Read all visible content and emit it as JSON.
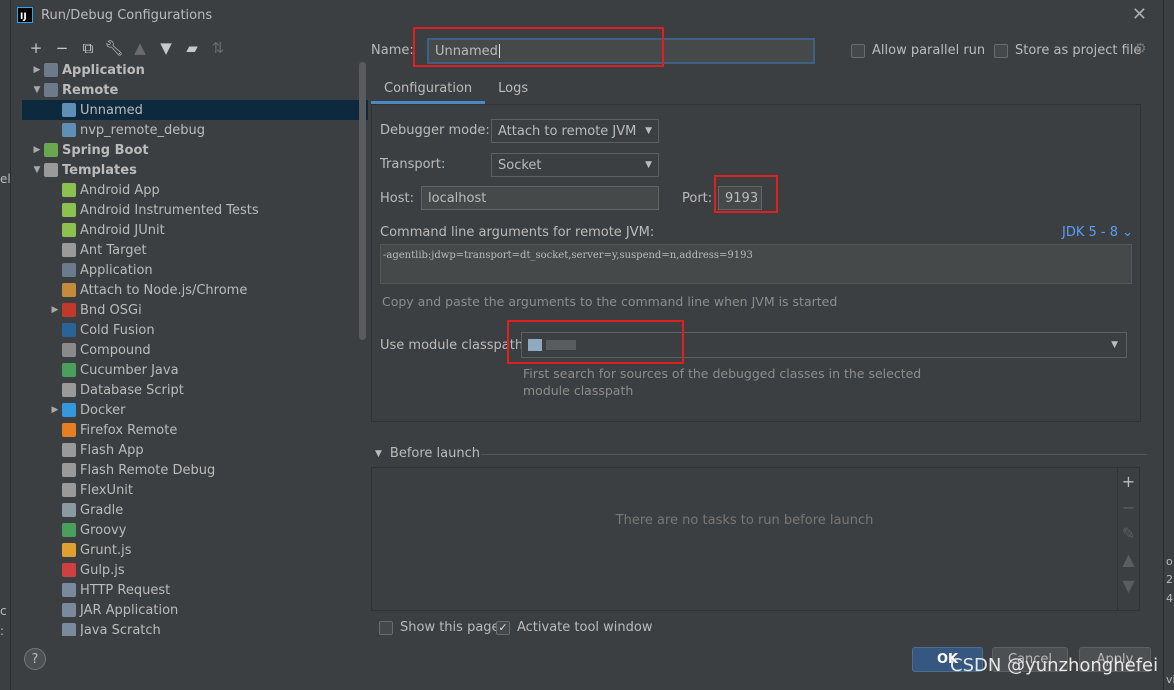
{
  "window": {
    "title": "Run/Debug Configurations",
    "app_icon": "IJ"
  },
  "ide_fragments": {
    "left_text": "el",
    "left_bottom": "c",
    "left_bottom2": ":",
    "right_text": "o",
    "right_text2": "2",
    "right_text3": "4",
    "right_bottom": "vi"
  },
  "toolbar": [
    "add-icon",
    "remove-icon",
    "copy-icon",
    "wrench-icon",
    "move-up-icon",
    "move-down-icon",
    "folder-icon",
    "sort-icon"
  ],
  "tree": [
    {
      "label": "Application",
      "level": 0,
      "arrow": "right",
      "bold": true,
      "icon": "application-icon",
      "icon_color": "#6b7b8c"
    },
    {
      "label": "Remote",
      "level": 0,
      "arrow": "down",
      "bold": true,
      "icon": "remote-icon",
      "icon_color": "#6b7b8c"
    },
    {
      "label": "Unnamed",
      "level": 1,
      "arrow": "",
      "bold": false,
      "selected": true,
      "icon": "remote-config-icon",
      "icon_color": "#5f8fb5"
    },
    {
      "label": "nvp_remote_debug",
      "level": 1,
      "arrow": "",
      "bold": false,
      "icon": "remote-config-icon",
      "icon_color": "#5f8fb5"
    },
    {
      "label": "Spring Boot",
      "level": 0,
      "arrow": "right",
      "bold": true,
      "icon": "spring-boot-icon",
      "icon_color": "#6aa84f"
    },
    {
      "label": "Templates",
      "level": 0,
      "arrow": "down",
      "bold": true,
      "icon": "wrench-icon",
      "icon_color": "#9a9a9a"
    },
    {
      "label": "Android App",
      "level": 1,
      "arrow": "",
      "icon": "android-icon",
      "icon_color": "#8cc152"
    },
    {
      "label": "Android Instrumented Tests",
      "level": 1,
      "arrow": "",
      "icon": "android-icon",
      "icon_color": "#8cc152"
    },
    {
      "label": "Android JUnit",
      "level": 1,
      "arrow": "",
      "icon": "android-icon",
      "icon_color": "#8cc152"
    },
    {
      "label": "Ant Target",
      "level": 1,
      "arrow": "",
      "icon": "ant-icon",
      "icon_color": "#9a9a9a"
    },
    {
      "label": "Application",
      "level": 1,
      "arrow": "",
      "icon": "application-icon",
      "icon_color": "#6b7b8c"
    },
    {
      "label": "Attach to Node.js/Chrome",
      "level": 1,
      "arrow": "",
      "icon": "nodejs-icon",
      "icon_color": "#c48c3a"
    },
    {
      "label": "Bnd OSGi",
      "level": 1,
      "arrow": "right",
      "icon": "osgi-icon",
      "icon_color": "#c0392b"
    },
    {
      "label": "Cold Fusion",
      "level": 1,
      "arrow": "",
      "icon": "coldfusion-icon",
      "icon_color": "#2a6496"
    },
    {
      "label": "Compound",
      "level": 1,
      "arrow": "",
      "icon": "compound-icon",
      "icon_color": "#8a8a8a"
    },
    {
      "label": "Cucumber Java",
      "level": 1,
      "arrow": "",
      "icon": "cucumber-icon",
      "icon_color": "#4aa05a"
    },
    {
      "label": "Database Script",
      "level": 1,
      "arrow": "",
      "icon": "database-icon",
      "icon_color": "#9a9a9a"
    },
    {
      "label": "Docker",
      "level": 1,
      "arrow": "right",
      "icon": "docker-icon",
      "icon_color": "#3498db"
    },
    {
      "label": "Firefox Remote",
      "level": 1,
      "arrow": "",
      "icon": "firefox-icon",
      "icon_color": "#e67e22"
    },
    {
      "label": "Flash App",
      "level": 1,
      "arrow": "",
      "icon": "flash-icon",
      "icon_color": "#9a9a9a"
    },
    {
      "label": "Flash Remote Debug",
      "level": 1,
      "arrow": "",
      "icon": "flash-icon",
      "icon_color": "#9a9a9a"
    },
    {
      "label": "FlexUnit",
      "level": 1,
      "arrow": "",
      "icon": "flexunit-icon",
      "icon_color": "#9a9a9a"
    },
    {
      "label": "Gradle",
      "level": 1,
      "arrow": "",
      "icon": "gradle-icon",
      "icon_color": "#8a9aa0"
    },
    {
      "label": "Groovy",
      "level": 1,
      "arrow": "",
      "icon": "groovy-icon",
      "icon_color": "#4aa05a"
    },
    {
      "label": "Grunt.js",
      "level": 1,
      "arrow": "",
      "icon": "grunt-icon",
      "icon_color": "#e0a030"
    },
    {
      "label": "Gulp.js",
      "level": 1,
      "arrow": "",
      "icon": "gulp-icon",
      "icon_color": "#d04040"
    },
    {
      "label": "HTTP Request",
      "level": 1,
      "arrow": "",
      "icon": "http-icon",
      "icon_color": "#7a8a9a"
    },
    {
      "label": "JAR Application",
      "level": 1,
      "arrow": "",
      "icon": "jar-icon",
      "icon_color": "#7a8a9a"
    },
    {
      "label": "Java Scratch",
      "level": 1,
      "arrow": "",
      "icon": "java-icon",
      "icon_color": "#7a8a9a"
    }
  ],
  "form": {
    "name_label": "Name:",
    "name_value": "Unnamed",
    "allow_parallel": "Allow parallel run",
    "store_project": "Store as project file",
    "tabs": [
      "Configuration",
      "Logs"
    ],
    "debugger_mode_label": "Debugger mode:",
    "debugger_mode_value": "Attach to remote JVM",
    "transport_label": "Transport:",
    "transport_value": "Socket",
    "host_label": "Host:",
    "host_value": "localhost",
    "port_label": "Port:",
    "port_value": "9193",
    "cmd_label": "Command line arguments for remote JVM:",
    "jdk_link": "JDK 5 - 8 ⌄",
    "cmd_value": "-agentlib:jdwp=transport=dt_socket,server=y,suspend=n,address=9193",
    "cmd_hint": "Copy and paste the arguments to the command line when JVM is started",
    "module_label": "Use module classpath:",
    "module_hint_1": "First search for sources of the debugged classes in the selected",
    "module_hint_2": "module classpath",
    "before_launch": "Before launch",
    "no_tasks": "There are no tasks to run before launch",
    "show_page": "Show this page",
    "activate_tool": "Activate tool window"
  },
  "buttons": {
    "help": "?",
    "ok": "OK",
    "cancel": "Cancel",
    "apply": "Apply"
  },
  "watermark": "CSDN @yunzhonghefei",
  "colors": {
    "accent": "#4a88c7",
    "highlight_box": "#e02020",
    "selection": "#0d293e",
    "link": "#589df6"
  }
}
